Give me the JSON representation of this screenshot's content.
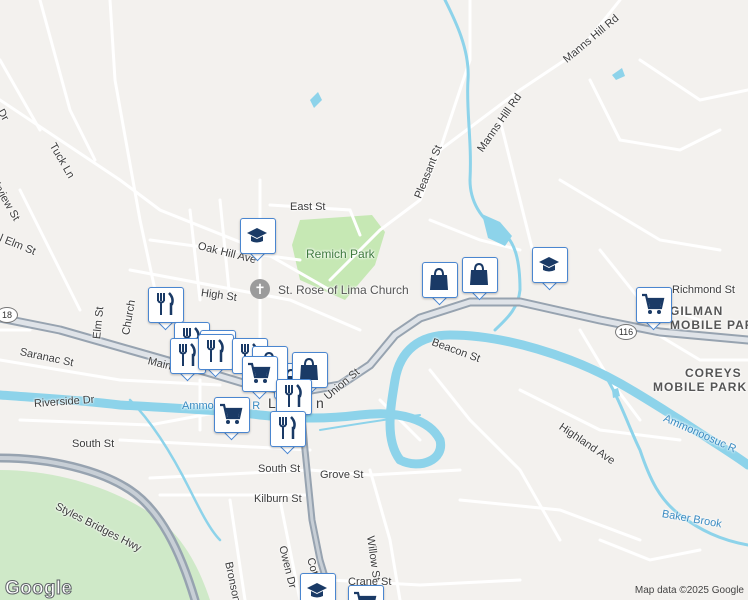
{
  "map": {
    "streets": {
      "east_st": "East St",
      "oak_hill_ave": "Oak Hill Ave",
      "high_st": "High St",
      "elm_st": "Elm St",
      "church_st": "Church",
      "main_st": "Main",
      "saranac_st": "Saranac St",
      "riverside_dr": "Riverside Dr",
      "south_st_upper": "South St",
      "south_st_lower": "South St",
      "grove_st": "Grove St",
      "kilburn_st": "Kilburn St",
      "owen_dr": "Owen Dr",
      "bronson_st": "Bronson St",
      "cottage_st": "Cottage",
      "willow_st": "Willow St",
      "crane_st": "Crane St",
      "union_st": "Union St",
      "beacon_st": "Beacon St",
      "highland_ave": "Highland Ave",
      "pleasant_st": "Pleasant St",
      "manns_hill_rd_upper": "Manns Hill Rd",
      "manns_hill_rd_lower": "Manns Hill Rd",
      "richmond_st": "Richmond St",
      "tuck_ln": "Tuck Ln",
      "fairview_st": "irview St",
      "n_elm_st": "l Elm St",
      "styles_bridges_hwy": "Styles Bridges Hwy",
      "dr_fragment": "Dr",
      "lisbon_fragment": "L",
      "lisbon_fragment2": "n"
    },
    "places": {
      "remich_park": "Remich Park",
      "st_rose_church": "St. Rose of Lima Church",
      "gilman_park": "GILMAN\nMOBILE PARK",
      "gilman_line1": "GILMAN",
      "gilman_line2": "MOBILE PARK",
      "coreys_line1": "COREYS",
      "coreys_line2": "MOBILE PARK"
    },
    "water": {
      "ammonoosuc_left": "Ammonoosuc R",
      "ammonoosuc_right": "Ammonoosuc R",
      "baker_brook": "Baker Brook"
    },
    "shields": {
      "rt18": "18",
      "rt116": "116"
    },
    "icons": [
      "school-icon",
      "shopping-bag-icon",
      "restaurant-icon",
      "shopping-cart-icon",
      "church-icon"
    ],
    "colors": {
      "background": "#f3f1ee",
      "water": "#8dd3ea",
      "park": "#c6e8b4",
      "golf_green": "#cfe9c8",
      "highway": "#a2adb9",
      "road": "#ffffff",
      "pin_border": "#4a86d0",
      "pin_icon": "#1a3a66"
    }
  },
  "footer": {
    "google": "Google",
    "attribution": "Map data ©2025 Google"
  }
}
